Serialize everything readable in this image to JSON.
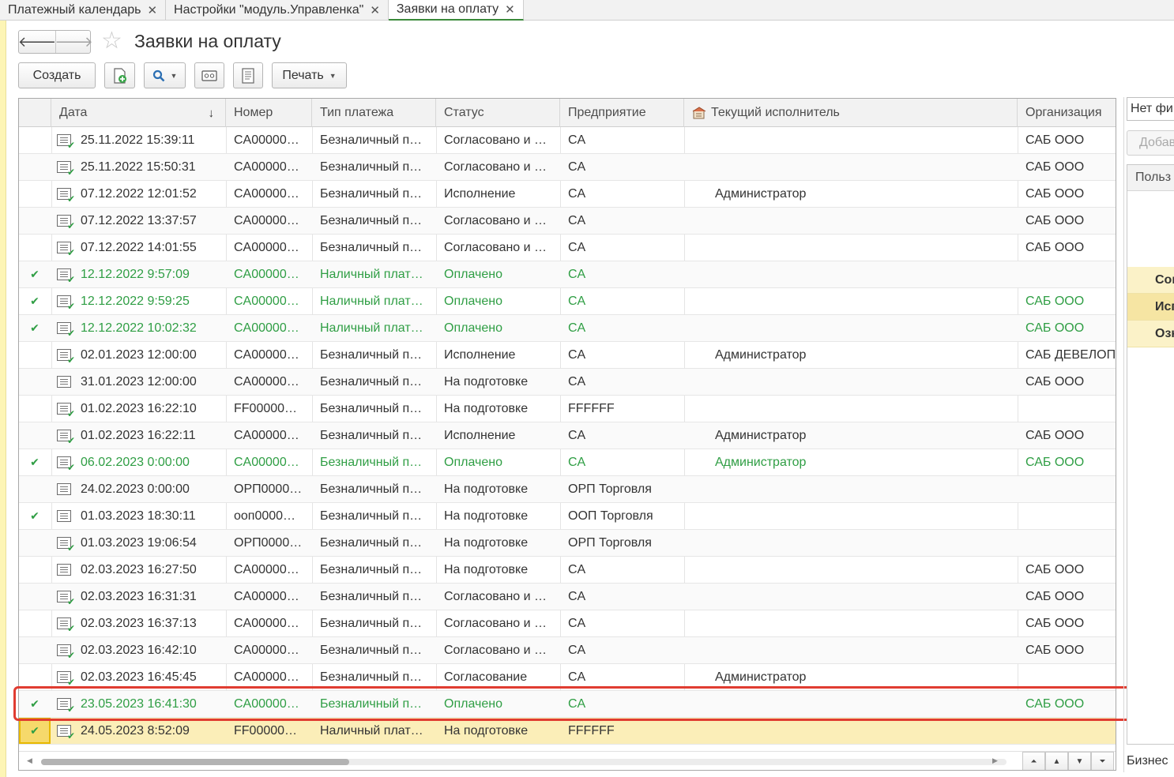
{
  "tabs": [
    {
      "label": "Платежный календарь",
      "active": false
    },
    {
      "label": "Настройки \"модуль.Управленка\"",
      "active": false
    },
    {
      "label": "Заявки на оплату",
      "active": true
    }
  ],
  "header": {
    "title": "Заявки на оплату"
  },
  "toolbar": {
    "create_label": "Создать",
    "print_label": "Печать"
  },
  "table": {
    "columns": [
      "Дата",
      "Номер",
      "Тип платежа",
      "Статус",
      "Предприятие",
      "Текущий исполнитель",
      "Организация"
    ],
    "rows": [
      {
        "check": "",
        "date": "25.11.2022 15:39:11",
        "number": "CA00000…",
        "type": "Безналичный п…",
        "status": "Согласовано и …",
        "enterprise": "CA",
        "executor": "",
        "org": "САБ ООО"
      },
      {
        "check": "",
        "date": "25.11.2022 15:50:31",
        "number": "CA00000…",
        "type": "Безналичный п…",
        "status": "Согласовано и …",
        "enterprise": "CA",
        "executor": "",
        "org": "САБ ООО"
      },
      {
        "check": "",
        "date": "07.12.2022 12:01:52",
        "number": "CA00000…",
        "type": "Безналичный п…",
        "status": "Исполнение",
        "enterprise": "CA",
        "executor": "Администратор",
        "org": "САБ ООО"
      },
      {
        "check": "",
        "date": "07.12.2022 13:37:57",
        "number": "CA00000…",
        "type": "Безналичный п…",
        "status": "Согласовано и …",
        "enterprise": "CA",
        "executor": "",
        "org": "САБ ООО"
      },
      {
        "check": "",
        "date": "07.12.2022 14:01:55",
        "number": "CA00000…",
        "type": "Безналичный п…",
        "status": "Согласовано и …",
        "enterprise": "CA",
        "executor": "",
        "org": "САБ ООО"
      },
      {
        "check": "✔",
        "date": "12.12.2022 9:57:09",
        "number": "CA00000…",
        "type": "Наличный плат…",
        "status": "Оплачено",
        "enterprise": "CA",
        "executor": "",
        "org": ""
      },
      {
        "check": "✔",
        "date": "12.12.2022 9:59:25",
        "number": "CA00000…",
        "type": "Наличный плат…",
        "status": "Оплачено",
        "enterprise": "CA",
        "executor": "",
        "org": "САБ ООО"
      },
      {
        "check": "✔",
        "date": "12.12.2022 10:02:32",
        "number": "CA00000…",
        "type": "Наличный плат…",
        "status": "Оплачено",
        "enterprise": "CA",
        "executor": "",
        "org": "САБ ООО"
      },
      {
        "check": "",
        "date": "02.01.2023 12:00:00",
        "number": "CA00000…",
        "type": "Безналичный п…",
        "status": "Исполнение",
        "enterprise": "CA",
        "executor": "Администратор",
        "org": "САБ ДЕВЕЛОП"
      },
      {
        "check": "",
        "date": "31.01.2023 12:00:00",
        "number": "CA00000…",
        "type": "Безналичный п…",
        "status": "На подготовке",
        "enterprise": "CA",
        "executor": "",
        "org": "САБ ООО"
      },
      {
        "check": "",
        "date": "01.02.2023 16:22:10",
        "number": "FF00000…",
        "type": "Безналичный п…",
        "status": "На подготовке",
        "enterprise": "FFFFFF",
        "executor": "",
        "org": ""
      },
      {
        "check": "",
        "date": "01.02.2023 16:22:11",
        "number": "CA00000…",
        "type": "Безналичный п…",
        "status": "Исполнение",
        "enterprise": "CA",
        "executor": "Администратор",
        "org": "САБ ООО"
      },
      {
        "check": "✔",
        "date": "06.02.2023 0:00:00",
        "number": "CA00000…",
        "type": "Безналичный п…",
        "status": "Оплачено",
        "enterprise": "CA",
        "executor": "Администратор",
        "org": "САБ ООО"
      },
      {
        "check": "",
        "date": "24.02.2023 0:00:00",
        "number": "ОРП0000…",
        "type": "Безналичный п…",
        "status": "На подготовке",
        "enterprise": "ОРП Торговля",
        "executor": "",
        "org": ""
      },
      {
        "check": "✔",
        "date": "01.03.2023 18:30:11",
        "number": "ооп0000…",
        "type": "Безналичный п…",
        "status": "На подготовке",
        "enterprise": "ООП Торговля",
        "executor": "",
        "org": ""
      },
      {
        "check": "",
        "date": "01.03.2023 19:06:54",
        "number": "ОРП0000…",
        "type": "Безналичный п…",
        "status": "На подготовке",
        "enterprise": "ОРП Торговля",
        "executor": "",
        "org": ""
      },
      {
        "check": "",
        "date": "02.03.2023 16:27:50",
        "number": "CA00000…",
        "type": "Безналичный п…",
        "status": "На подготовке",
        "enterprise": "CA",
        "executor": "",
        "org": "САБ ООО"
      },
      {
        "check": "",
        "date": "02.03.2023 16:31:31",
        "number": "CA00000…",
        "type": "Безналичный п…",
        "status": "Согласовано и …",
        "enterprise": "CA",
        "executor": "",
        "org": "САБ ООО"
      },
      {
        "check": "",
        "date": "02.03.2023 16:37:13",
        "number": "CA00000…",
        "type": "Безналичный п…",
        "status": "Согласовано и …",
        "enterprise": "CA",
        "executor": "",
        "org": "САБ ООО"
      },
      {
        "check": "",
        "date": "02.03.2023 16:42:10",
        "number": "CA00000…",
        "type": "Безналичный п…",
        "status": "Согласовано и …",
        "enterprise": "CA",
        "executor": "",
        "org": "САБ ООО"
      },
      {
        "check": "",
        "date": "02.03.2023 16:45:45",
        "number": "CA00000…",
        "type": "Безналичный п…",
        "status": "Согласование",
        "enterprise": "CA",
        "executor": "Администратор",
        "org": ""
      },
      {
        "check": "✔",
        "date": "23.05.2023 16:41:30",
        "number": "CA00000…",
        "type": "Безналичный п…",
        "status": "Оплачено",
        "enterprise": "CA",
        "executor": "",
        "org": "САБ ООО"
      },
      {
        "check": "✔",
        "date": "24.05.2023 8:52:09",
        "number": "FF00000…",
        "type": "Наличный плат…",
        "status": "На подготовке",
        "enterprise": "FFFFFF",
        "executor": "",
        "org": ""
      }
    ]
  },
  "right_panel": {
    "filter_value": "Нет фи",
    "add_label": "Добав",
    "list_header": "Польз",
    "items": [
      "Сог",
      "Исп",
      "Озн"
    ],
    "footer": "Бизнес"
  },
  "colors": {
    "paid_text": "#2f9e44",
    "highlight": "#e03c31",
    "selected_row": "#fbeeb8",
    "active_tab_underline": "#3a8a3a"
  }
}
